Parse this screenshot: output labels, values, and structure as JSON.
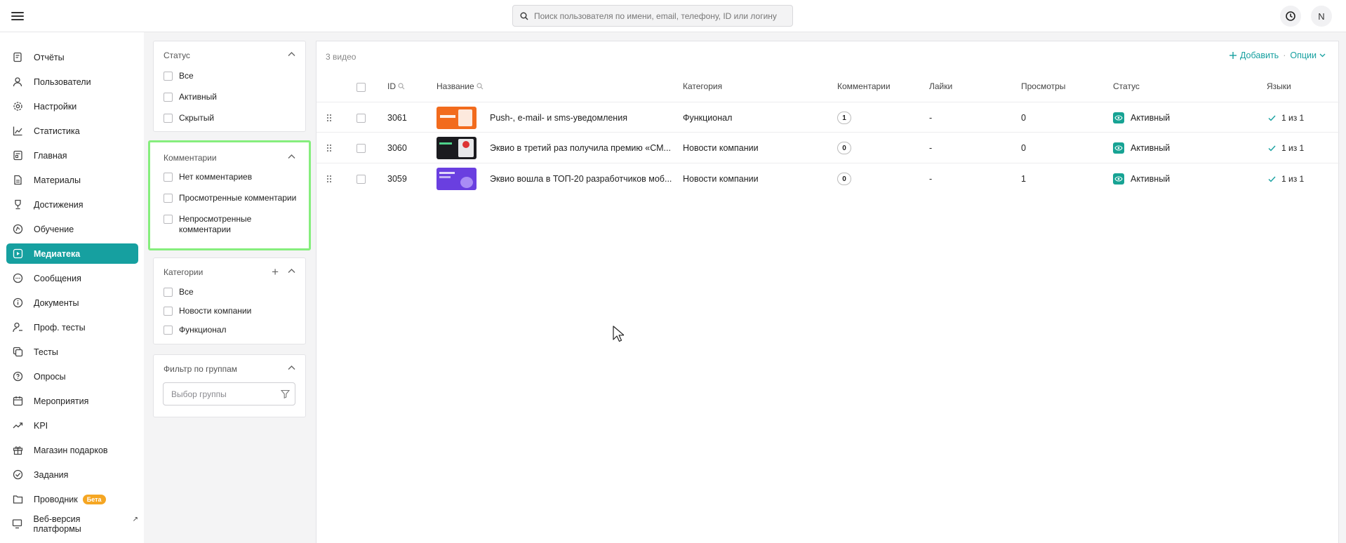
{
  "search": {
    "placeholder": "Поиск пользователя по имени, email, телефону, ID или логину"
  },
  "user": {
    "initial": "N"
  },
  "sidebar": {
    "items": [
      {
        "label": "Отчёты",
        "icon": "report-icon"
      },
      {
        "label": "Пользователи",
        "icon": "users-icon"
      },
      {
        "label": "Настройки",
        "icon": "gear-icon"
      },
      {
        "label": "Статистика",
        "icon": "chart-icon"
      },
      {
        "label": "Главная",
        "icon": "home-icon"
      },
      {
        "label": "Материалы",
        "icon": "document-icon"
      },
      {
        "label": "Достижения",
        "icon": "trophy-icon"
      },
      {
        "label": "Обучение",
        "icon": "learning-icon"
      },
      {
        "label": "Медиатека",
        "icon": "video-icon",
        "active": true
      },
      {
        "label": "Сообщения",
        "icon": "chat-icon"
      },
      {
        "label": "Документы",
        "icon": "info-icon"
      },
      {
        "label": "Проф. тесты",
        "icon": "person-test-icon"
      },
      {
        "label": "Тесты",
        "icon": "tests-icon"
      },
      {
        "label": "Опросы",
        "icon": "poll-icon"
      },
      {
        "label": "Мероприятия",
        "icon": "calendar-icon"
      },
      {
        "label": "KPI",
        "icon": "trend-icon"
      },
      {
        "label": "Магазин подарков",
        "icon": "gift-icon"
      },
      {
        "label": "Задания",
        "icon": "check-circle-icon"
      },
      {
        "label": "Проводник",
        "icon": "folder-icon",
        "badge": "Бета"
      },
      {
        "label": "Веб-версия платформы",
        "icon": "monitor-icon",
        "external": "↗"
      }
    ]
  },
  "filters": {
    "status": {
      "title": "Статус",
      "options": [
        "Все",
        "Активный",
        "Скрытый"
      ]
    },
    "comments": {
      "title": "Комментарии",
      "options": [
        "Нет комментариев",
        "Просмотренные комментарии",
        "Непросмотренные комментарии"
      ]
    },
    "categories": {
      "title": "Категории",
      "options": [
        "Все",
        "Новости компании",
        "Функционал"
      ]
    },
    "groups": {
      "title": "Фильтр по группам",
      "placeholder": "Выбор группы"
    }
  },
  "main": {
    "count": "3 видео",
    "add_label": "Добавить",
    "separator": "·",
    "options_label": "Опции",
    "columns": {
      "id": "ID",
      "name": "Название",
      "category": "Категория",
      "comments": "Комментарии",
      "likes": "Лайки",
      "views": "Просмотры",
      "status": "Статус",
      "languages": "Языки"
    },
    "rows": [
      {
        "id": "3061",
        "name": "Push-, e-mail- и sms-уведомления",
        "category": "Функционал",
        "comments": "1",
        "likes": "-",
        "views": "0",
        "status": "Активный",
        "languages": "1 из 1",
        "thumb_color": "#f26b1d"
      },
      {
        "id": "3060",
        "name": "Эквио в третий раз получила премию «СМ...",
        "category": "Новости компании",
        "comments": "0",
        "likes": "-",
        "views": "0",
        "status": "Активный",
        "languages": "1 из 1",
        "thumb_color": "#1b1b1f"
      },
      {
        "id": "3059",
        "name": "Эквио вошла в ТОП-20 разработчиков моб...",
        "category": "Новости компании",
        "comments": "0",
        "likes": "-",
        "views": "1",
        "status": "Активный",
        "languages": "1 из 1",
        "thumb_color": "#6a3fe0"
      }
    ]
  },
  "colors": {
    "accent": "#16a0a0",
    "highlight": "#86ee7d",
    "status_active": "#17a394",
    "beta": "#f5a623"
  }
}
